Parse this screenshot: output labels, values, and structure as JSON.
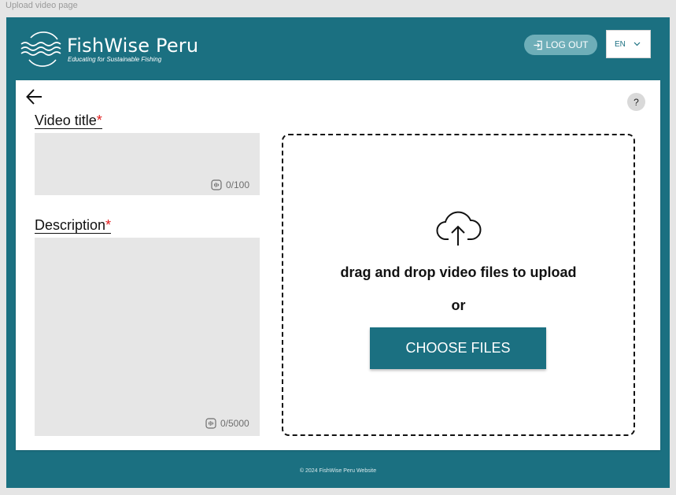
{
  "frame": {
    "label": "Upload video page"
  },
  "header": {
    "brand": "FishWise Peru",
    "tagline": "Educating for Sustainable Fishing",
    "logout_label": "LOG OUT",
    "language": "EN"
  },
  "form": {
    "title_label": "Video title",
    "title_required": "*",
    "title_counter": "0/100",
    "description_label": "Description",
    "description_required": "*",
    "description_counter": "0/5000",
    "help_label": "?"
  },
  "upload": {
    "drop_text": "drag and drop video files to upload",
    "or_text": "or",
    "choose_label": "CHOOSE FILES"
  },
  "footer": {
    "copyright": "© 2024 FishWise Peru Website"
  },
  "colors": {
    "brand": "#1b7081",
    "logout": "#6eaeb8",
    "required": "#e01b1b",
    "input_bg": "#e6e6e6"
  },
  "icons": [
    "waves-logo-icon",
    "login-icon",
    "chevron-down-icon",
    "arrow-left-icon",
    "help-icon",
    "audio-wave-icon",
    "cloud-upload-icon"
  ]
}
